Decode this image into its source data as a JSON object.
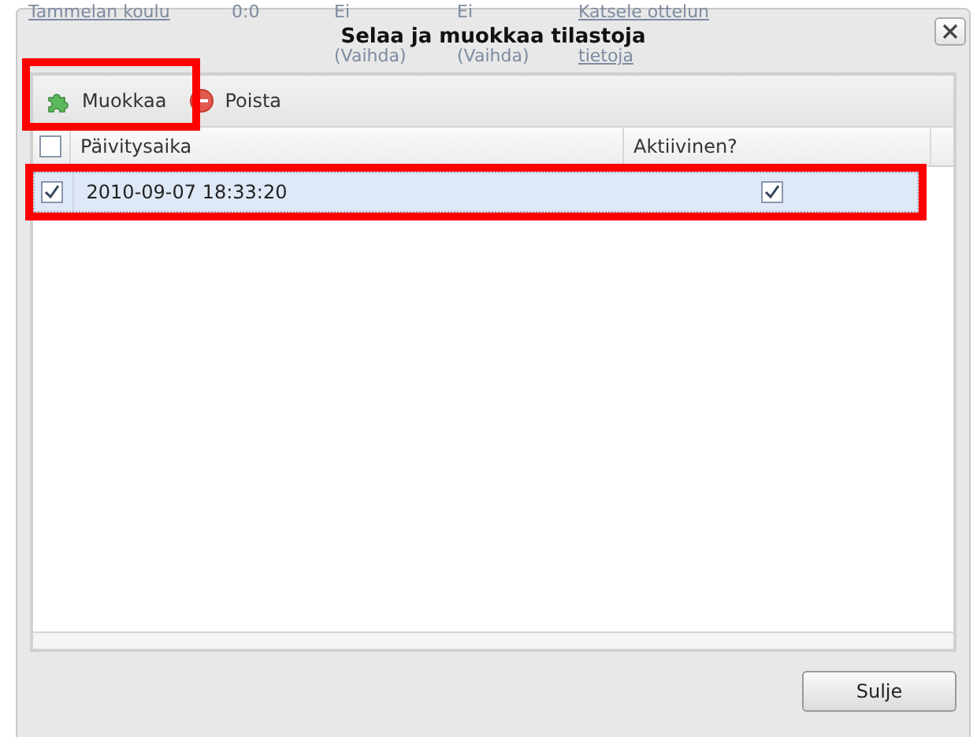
{
  "background_page": {
    "team": "Tammelan koulu",
    "score": "0:0",
    "column_3": {
      "value": "Ei",
      "action": "(Vaihda)"
    },
    "column_4": {
      "value": "Ei",
      "action": "(Vaihda)"
    },
    "link_lines": [
      "Katsele ottelun",
      "tietoja"
    ]
  },
  "dialog": {
    "title": "Selaa ja muokkaa tilastoja",
    "toolbar": [
      {
        "label": "Muokkaa",
        "kind": "edit",
        "annotated": true
      },
      {
        "label": "Poista",
        "kind": "delete",
        "annotated": false
      }
    ],
    "grid": {
      "select_all_checked": false,
      "columns": [
        "Päivitysaika",
        "Aktiivinen?"
      ],
      "rows": [
        {
          "time": "2010-09-07 18:33:20",
          "checked": true,
          "active": true,
          "selected": true,
          "annotated": true
        }
      ]
    },
    "buttons": [
      "Sulje"
    ]
  }
}
